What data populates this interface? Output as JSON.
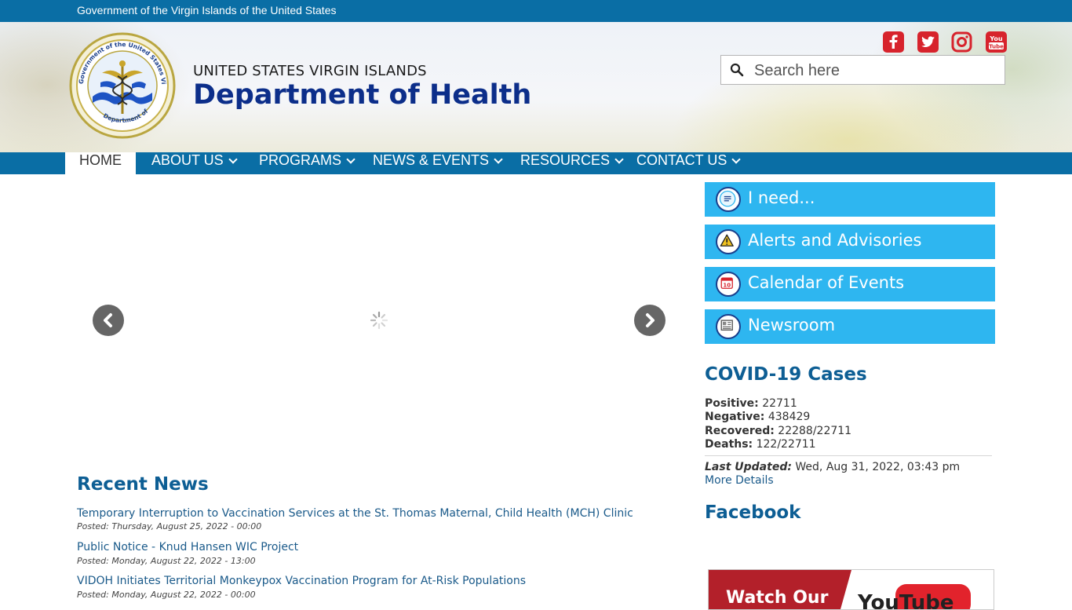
{
  "topbar": {
    "text": "Government of the Virgin Islands of the United States"
  },
  "brand": {
    "top": "UNITED STATES VIRGIN ISLANDS",
    "main": "Department of Health"
  },
  "seal": {
    "ring_top": "Government of the United States Virgin Islands",
    "ring_bottom": "Department of Health"
  },
  "social": [
    "facebook-icon",
    "twitter-icon",
    "instagram-icon",
    "youtube-icon"
  ],
  "search": {
    "placeholder": "Search here",
    "value": ""
  },
  "nav": {
    "home": "HOME",
    "about": "ABOUT US",
    "programs": "PROGRAMS",
    "news": "NEWS & EVENTS",
    "resources": "RESOURCES",
    "contact": "CONTACT US"
  },
  "quick_links": {
    "need": "I need...",
    "alerts": "Alerts and Advisories",
    "calendar": "Calendar of Events",
    "newsroom": "Newsroom"
  },
  "covid": {
    "title": "COVID-19 Cases",
    "positive_label": "Positive:",
    "positive_value": "22711",
    "negative_label": "Negative:",
    "negative_value": "438429",
    "recovered_label": "Recovered:",
    "recovered_value": "22288/22711",
    "deaths_label": "Deaths:",
    "deaths_value": "122/22711",
    "updated_label": "Last Updated:",
    "updated_value": "Wed, Aug 31, 2022, 03:43 pm",
    "more": "More Details"
  },
  "facebook": {
    "title": "Facebook"
  },
  "youtube_banner": {
    "left": "Watch Our",
    "right": "YouTube"
  },
  "news": {
    "title": "Recent News",
    "items": [
      {
        "title": "Temporary Interruption to Vaccination Services at the St. Thomas Maternal, Child Health (MCH) Clinic",
        "posted": "Posted: Thursday, August 25, 2022 - 00:00"
      },
      {
        "title": "Public Notice - Knud Hansen WIC Project",
        "posted": "Posted: Monday, August 22, 2022 - 13:00"
      },
      {
        "title": "VIDOH Initiates Territorial Monkeypox Vaccination Program for At-Risk Populations",
        "posted": "Posted: Monday, August 22, 2022 - 00:00"
      }
    ]
  },
  "colors": {
    "primary": "#0a6ea5",
    "accent": "#2eb6f0",
    "heading": "#0d5e94",
    "brand": "#0c2e8a"
  }
}
